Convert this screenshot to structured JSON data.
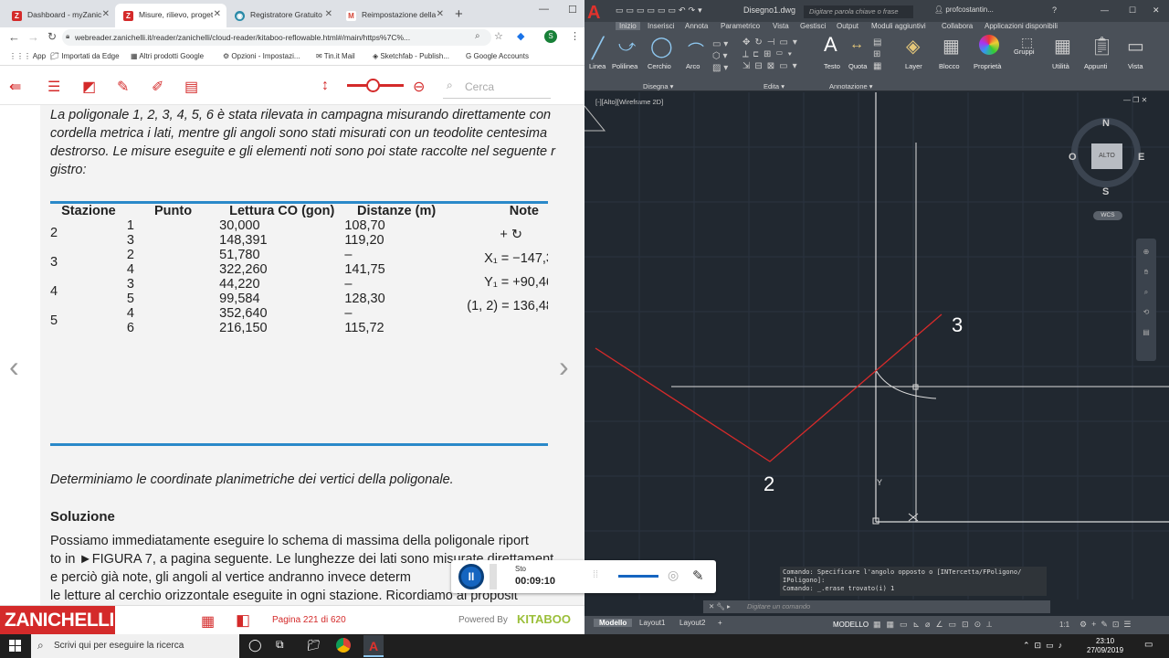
{
  "chrome": {
    "tabs": [
      {
        "label": "Dashboard - myZanic",
        "favicon": "Z",
        "color": "#d42a2a"
      },
      {
        "label": "Misure, rilievo, proget",
        "favicon": "Z",
        "color": "#d42a2a"
      },
      {
        "label": "Registratore Gratuito",
        "favicon": "◉",
        "color": "#2a8aa8"
      },
      {
        "label": "Reimpostazione della",
        "favicon": "M",
        "color": "#d44638"
      }
    ],
    "url": "webreader.zanichelli.it/reader/zanichelli/cloud-reader/kitaboo-reflowable.html#/main/https%7C%...",
    "bookmarks": [
      "App",
      "Importati da Edge",
      "Altri prodotti Google",
      "Opzioni - Impostazi...",
      "Tin.it Mail",
      "Sketchfab - Publish...",
      "Google Accounts"
    ],
    "profile_letter": "S"
  },
  "reader": {
    "search_placeholder": "Cerca",
    "intro_lines": [
      "La poligonale 1, 2, 3, 4, 5, 6 è stata rilevata in campagna misurando direttamente con",
      "cordella metrica i lati, mentre gli angoli sono stati misurati con un teodolite centesima",
      "destrorso. Le misure eseguite e gli elementi noti sono poi state raccolte nel seguente r",
      "gistro:"
    ],
    "table": {
      "headers": [
        "Stazione",
        "Punto",
        "Lettura CO (gon)",
        "Distanze (m)",
        "Note"
      ],
      "groups": [
        {
          "stazione": "2",
          "rows": [
            [
              "1",
              "30,000",
              "108,70"
            ],
            [
              "3",
              "148,391",
              "119,20"
            ]
          ]
        },
        {
          "stazione": "3",
          "rows": [
            [
              "2",
              "51,780",
              "–"
            ],
            [
              "4",
              "322,260",
              "141,75"
            ]
          ]
        },
        {
          "stazione": "4",
          "rows": [
            [
              "3",
              "44,220",
              "–"
            ],
            [
              "5",
              "99,584",
              "128,30"
            ]
          ]
        },
        {
          "stazione": "5",
          "rows": [
            [
              "4",
              "352,640",
              "–"
            ],
            [
              "6",
              "216,150",
              "115,72"
            ]
          ]
        }
      ],
      "notes": [
        "+ ↻",
        "X₁ = −147,3",
        "Y₁ = +90,46",
        "(1, 2) = 136,48"
      ]
    },
    "question": "Determiniamo le coordinate planimetriche dei vertici della poligonale.",
    "solution_title": "Soluzione",
    "solution_lines": [
      "Possiamo immediatamente eseguire lo schema di massima della poligonale riport",
      "to in ►FIGURA 7, a pagina seguente. Le lunghezze dei lati sono misurate direttament",
      "e perciò già note, gli angoli al vertice andranno invece determ",
      "le letture al cerchio orizzontale eseguite in ogni stazione. Ricordiamo al proposit"
    ],
    "brand": "ZANICHELLI",
    "page_indicator": "Pagina 221 di 620",
    "powered_by": "Powered By",
    "kitaboo": "KITABOO"
  },
  "recorder": {
    "status": "Sto",
    "time": "00:09:10"
  },
  "acad": {
    "file": "Disegno1.dwg",
    "search_placeholder": "Digitare parola chiave o frase",
    "user": "profcostantin...",
    "ribbon_tabs": [
      "Inizio",
      "Inserisci",
      "Annota",
      "Parametrico",
      "Vista",
      "Gestisci",
      "Output",
      "Moduli aggiuntivi",
      "Collabora",
      "Applicazioni disponibili"
    ],
    "tools": [
      "Linea",
      "Polilinea",
      "Cerchio",
      "Arco",
      "Testo",
      "Quota",
      "Layer",
      "Blocco",
      "Proprietà",
      "Gruppi",
      "Utilità",
      "Appunti",
      "Vista"
    ],
    "panels": [
      "Disegna",
      "Edita",
      "Annotazione"
    ],
    "viewport_label": "[-][Alto][Wireframe 2D]",
    "compass": {
      "n": "N",
      "s": "S",
      "e": "E",
      "o": "O",
      "center": "ALTO",
      "wcs": "WCS"
    },
    "point_labels": [
      "3",
      "2"
    ],
    "ucs_y": "Y",
    "command_history": [
      "Comando: Specificare l'angolo opposto o [INTercetta/FPoligono/",
      "IPoligono]:",
      "Comando: _.erase trovato(i) 1"
    ],
    "command_placeholder": "Digitare un comando",
    "layout_tabs": [
      "Modello",
      "Layout1",
      "Layout2"
    ],
    "status_model": "MODELLO",
    "scale": "1:1"
  },
  "taskbar": {
    "search": "Scrivi qui per eseguire la ricerca",
    "time": "23:10",
    "date": "27/09/2019"
  }
}
